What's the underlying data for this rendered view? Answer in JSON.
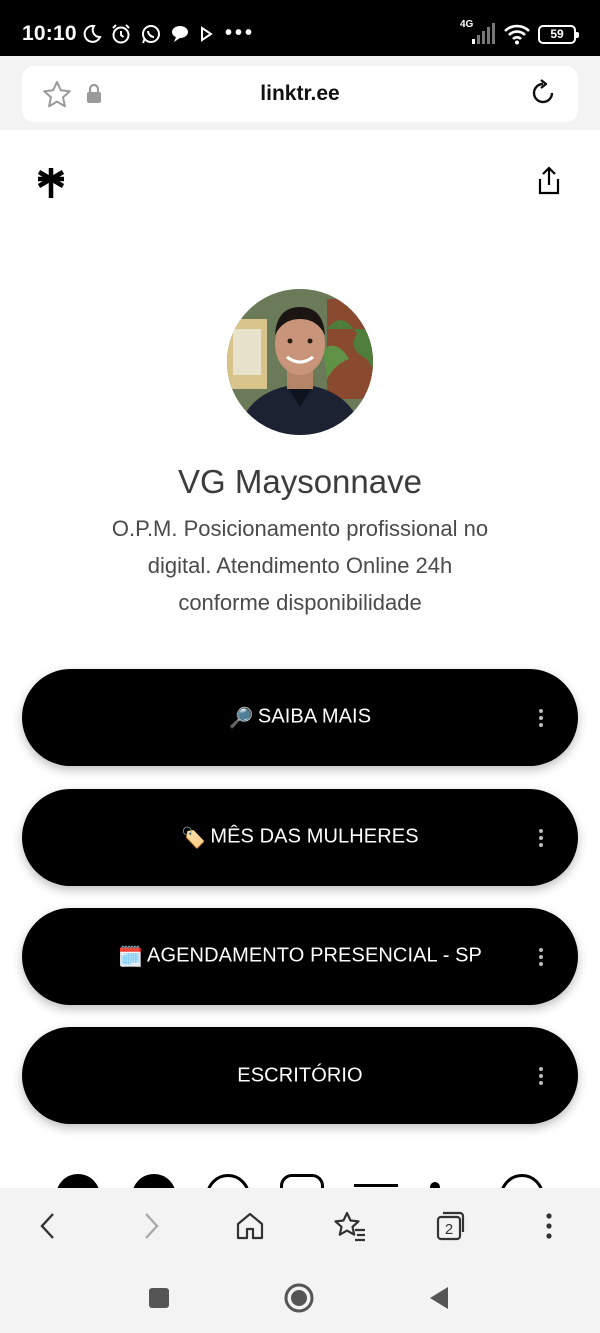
{
  "status_bar": {
    "time": "10:10",
    "network": "4G",
    "battery": "59",
    "more_indicator": "•••"
  },
  "browser": {
    "url": "linktr.ee",
    "tab_count": "2"
  },
  "profile": {
    "name": "VG Maysonnave",
    "bio": "O.P.M. Posicionamento profissional no digital. Atendimento Online 24h conforme disponibilidade"
  },
  "links": [
    {
      "emoji": "🔎",
      "label": "SAIBA MAIS"
    },
    {
      "emoji": "🏷️",
      "label": "MÊS DAS MULHERES"
    },
    {
      "emoji": "🗓️",
      "label": "AGENDAMENTO PRESENCIAL - SP"
    },
    {
      "emoji": "",
      "label": "ESCRITÓRIO"
    }
  ],
  "social_icons": [
    "tiktok-icon",
    "facebook-icon",
    "whatsapp-icon",
    "instagram-icon",
    "email-icon",
    "person-icon",
    "website-icon"
  ],
  "icons": {
    "logo": "linktree-logo-icon",
    "share": "share-icon",
    "bookmark": "star-icon",
    "lock": "lock-icon",
    "reload": "reload-icon"
  },
  "colors": {
    "button_bg": "#000000",
    "button_text": "#ffffff",
    "page_bg": "#ffffff",
    "chrome_bg": "#f3f3f3"
  }
}
